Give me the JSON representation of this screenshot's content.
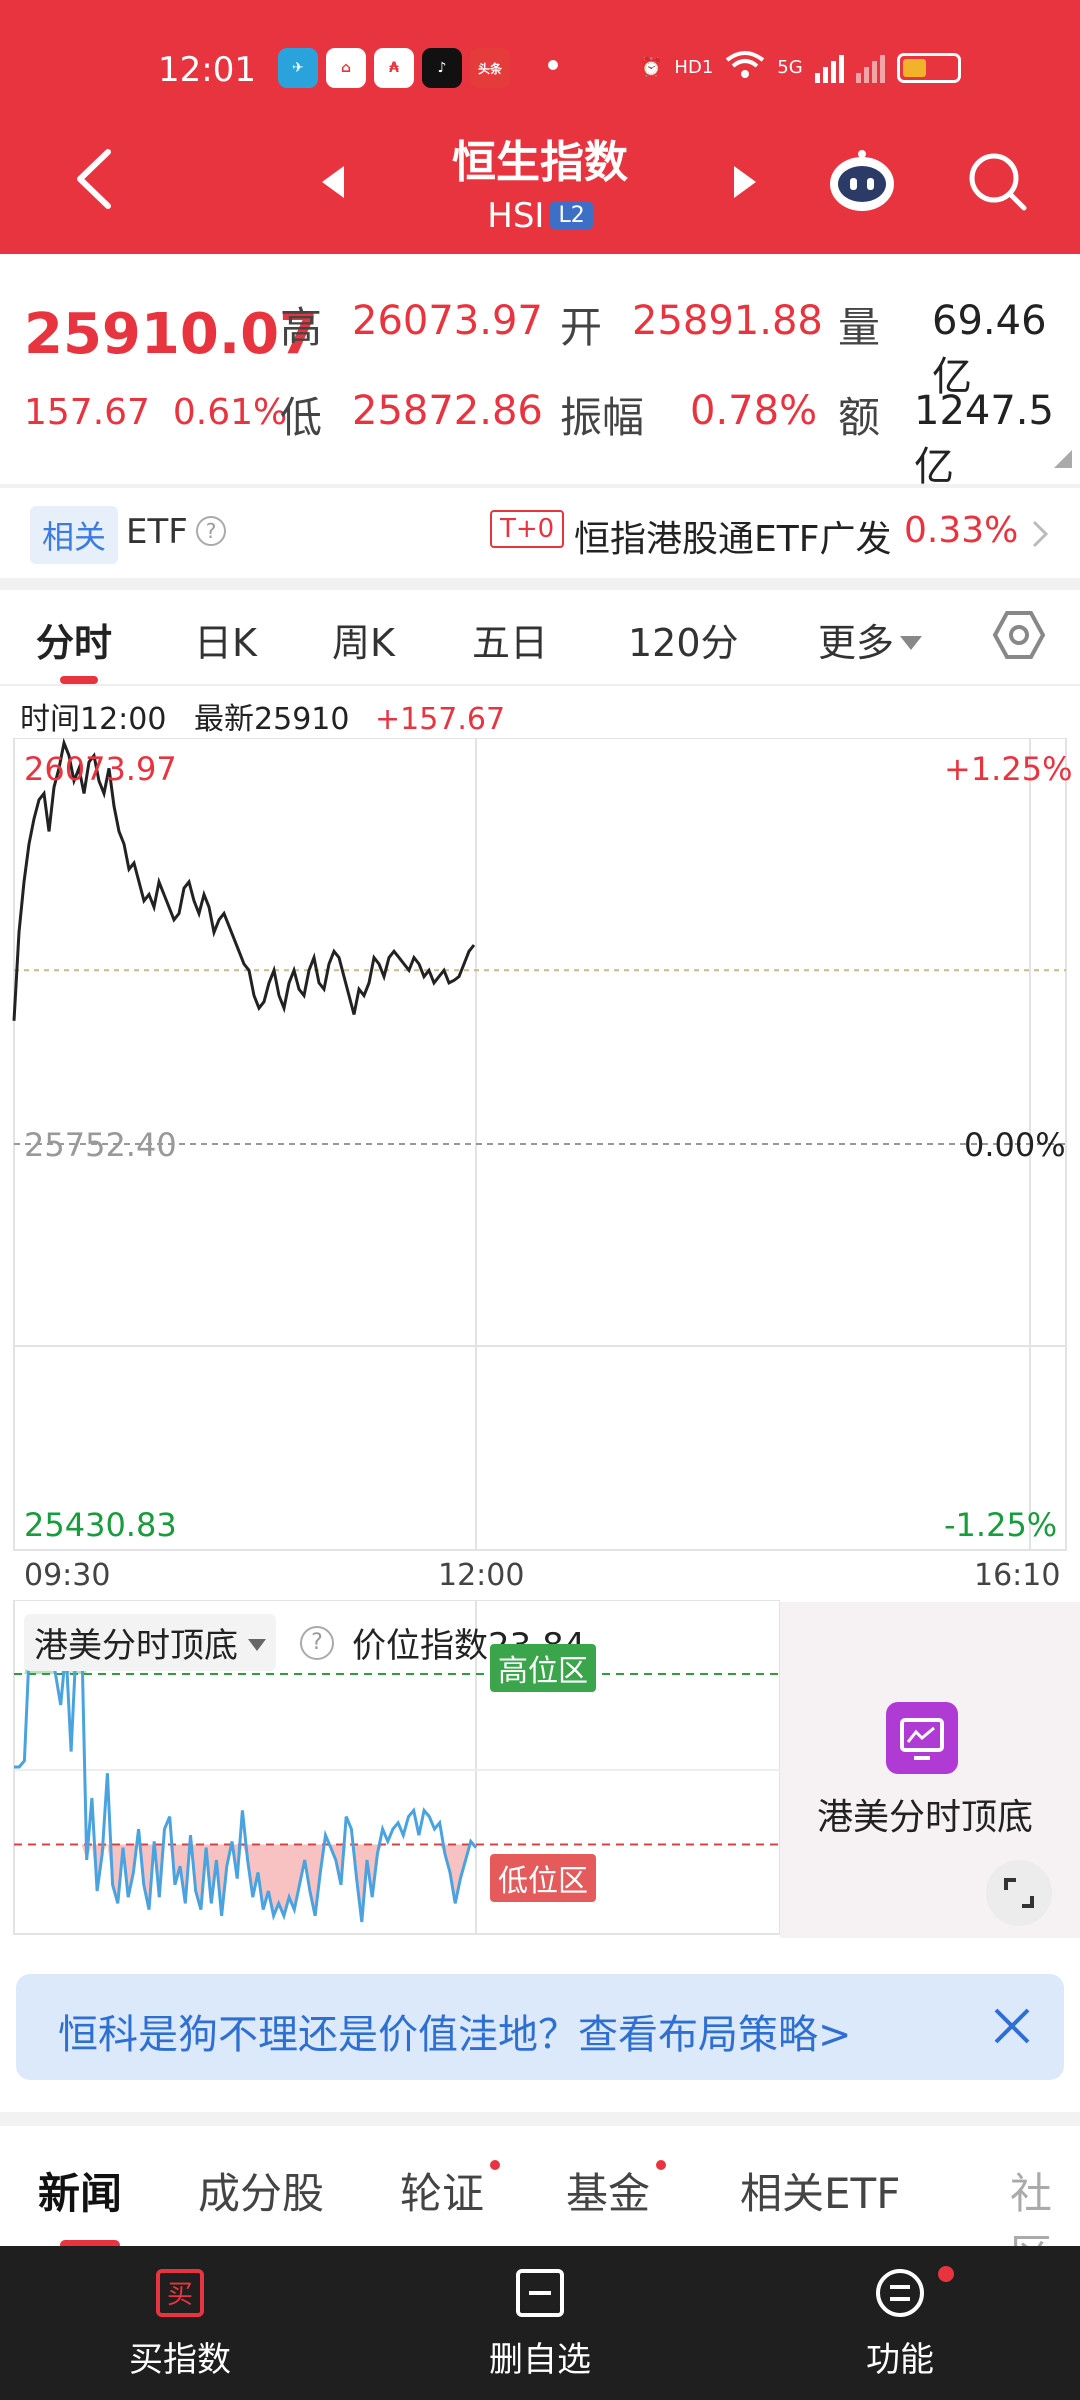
{
  "status_bar": {
    "time": "12:01",
    "apps": [
      "telegram-icon",
      "app-icon",
      "app-icon",
      "tiktok-icon",
      "toutiao-icon"
    ],
    "toutiao_label": "头条",
    "hd_label": "HD1",
    "net_label": "5G",
    "battery_level": 0.45
  },
  "header": {
    "title": "恒生指数",
    "subtitle": "HSI",
    "badge": "L2"
  },
  "quote": {
    "price": "25910.07",
    "change": "157.67",
    "change_pct": "0.61%",
    "high_label": "高",
    "high": "26073.97",
    "open_label": "开",
    "open": "25891.88",
    "volume_label": "量",
    "volume": "69.46亿",
    "low_label": "低",
    "low": "25872.86",
    "amplitude_label": "振幅",
    "amplitude": "0.78%",
    "turnover_label": "额",
    "turnover": "1247.5亿"
  },
  "etf_row": {
    "tag": "相关",
    "label": "ETF",
    "help": "?",
    "t0": "T+0",
    "name": "恒指港股通ETF广发",
    "pct": "0.33%"
  },
  "tabs": [
    "分时",
    "日K",
    "周K",
    "五日",
    "120分",
    "更多"
  ],
  "chart_info": {
    "time_label": "时间12:00",
    "latest_label": "最新25910",
    "change": "+157.67"
  },
  "chart_data": {
    "type": "line",
    "y_left_top": "26073.97",
    "y_left_mid": "25752.40",
    "y_left_bottom": "25430.83",
    "y_right_top": "+1.25%",
    "y_right_mid": "0.00%",
    "y_right_bottom": "-1.25%",
    "x_labels": [
      "09:30",
      "12:00",
      "16:10"
    ],
    "ylim": [
      25430.83,
      26073.97
    ],
    "avg_level": 25890,
    "series": [
      {
        "values": [
          25850,
          25920,
          25960,
          25990,
          26010,
          26025,
          26030,
          26000,
          26035,
          26050,
          26070,
          26060,
          26040,
          26050,
          26030,
          26055,
          26060,
          26040,
          26030,
          26050,
          26020,
          26000,
          25990,
          25970,
          25975,
          25960,
          25945,
          25950,
          25940,
          25960,
          25950,
          25940,
          25930,
          25935,
          25955,
          25960,
          25945,
          25935,
          25950,
          25940,
          25920,
          25930,
          25935,
          25925,
          25915,
          25905,
          25895,
          25890,
          25870,
          25860,
          25865,
          25880,
          25890,
          25870,
          25860,
          25880,
          25890,
          25875,
          25870,
          25890,
          25900,
          25880,
          25875,
          25895,
          25905,
          25900,
          25885,
          25870,
          25855,
          25875,
          25870,
          25880,
          25900,
          25895,
          25885,
          25900,
          25905,
          25900,
          25895,
          25890,
          25900,
          25895,
          25885,
          25890,
          25880,
          25885,
          25890,
          25880,
          25882,
          25885,
          25895,
          25905,
          25910
        ]
      }
    ]
  },
  "indicator": {
    "name": "港美分时顶底",
    "help": "?",
    "value_label": "价位指数23.84",
    "high_zone": "高位区",
    "low_zone": "低位区",
    "ylim": [
      0,
      100
    ],
    "high_level": 80,
    "low_level": 25,
    "values": [
      50,
      50,
      52,
      90,
      98,
      92,
      85,
      92,
      80,
      70,
      88,
      55,
      90,
      95,
      20,
      40,
      10,
      22,
      48,
      12,
      6,
      24,
      8,
      16,
      30,
      12,
      4,
      26,
      8,
      30,
      34,
      12,
      18,
      6,
      28,
      10,
      4,
      24,
      6,
      20,
      2,
      18,
      26,
      14,
      36,
      20,
      8,
      16,
      4,
      10,
      2,
      6,
      2,
      8,
      4,
      12,
      20,
      10,
      2,
      16,
      28,
      24,
      20,
      12,
      34,
      30,
      14,
      0,
      20,
      8,
      22,
      30,
      26,
      30,
      32,
      28,
      34,
      36,
      28,
      36,
      34,
      30,
      32,
      22,
      16,
      6,
      14,
      20,
      26,
      24
    ]
  },
  "side_card": {
    "label": "港美分时顶底"
  },
  "banner": {
    "text": "恒科是狗不理还是价值洼地？查看布局策略>"
  },
  "bottom_tabs": [
    "新闻",
    "成分股",
    "轮证",
    "基金",
    "相关ETF",
    "社区"
  ],
  "bottom_nav": [
    {
      "label": "买指数",
      "icon": "买"
    },
    {
      "label": "删自选",
      "icon": ""
    },
    {
      "label": "功能",
      "icon": ""
    }
  ],
  "colors": {
    "header_red": "#e8343f",
    "up_red": "#e8343f",
    "down_green": "#1a9b3d",
    "line_black": "#222222",
    "indicator_blue": "#4aa3df"
  }
}
